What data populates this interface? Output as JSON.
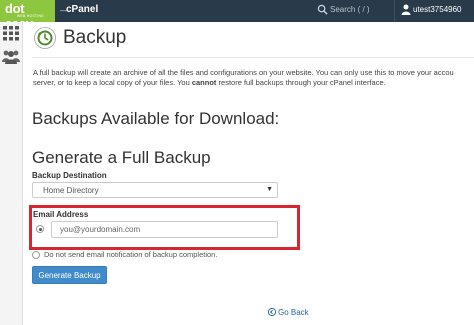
{
  "topbar": {
    "logo_text": "dot easy",
    "logo_tagline": "WEB HOSTING",
    "brand_dash": "—",
    "brand": "cPanel",
    "search_placeholder": "Search ( / )",
    "username": "utest3754960"
  },
  "page": {
    "title": "Backup",
    "description_part1": "A full backup will create an archive of all the files and configurations on your website. You can only use this to move your accou",
    "description_part2": "server, or to keep a local copy of your files. You ",
    "description_bold": "cannot",
    "description_part3": " restore full backups through your cPanel interface.",
    "download_heading": "Backups Available for Download:",
    "generate_heading": "Generate a Full Backup",
    "destination_label": "Backup Destination",
    "destination_value": "Home Directory",
    "email_label": "Email Address",
    "email_placeholder": "you@yourdomain.com",
    "no_email_label": "Do not send email notification of backup completion.",
    "generate_button": "Generate Backup",
    "go_back": "Go Back"
  },
  "colors": {
    "topbar": "#293a4a",
    "logo_green": "#8dc63f",
    "primary_button": "#428bca",
    "highlight_red": "#d7262e",
    "link": "#2a6496"
  },
  "icons": [
    "search-icon",
    "user-icon",
    "grid-icon",
    "users-icon",
    "backup-icon",
    "chevron-down-icon",
    "go-back-icon"
  ]
}
